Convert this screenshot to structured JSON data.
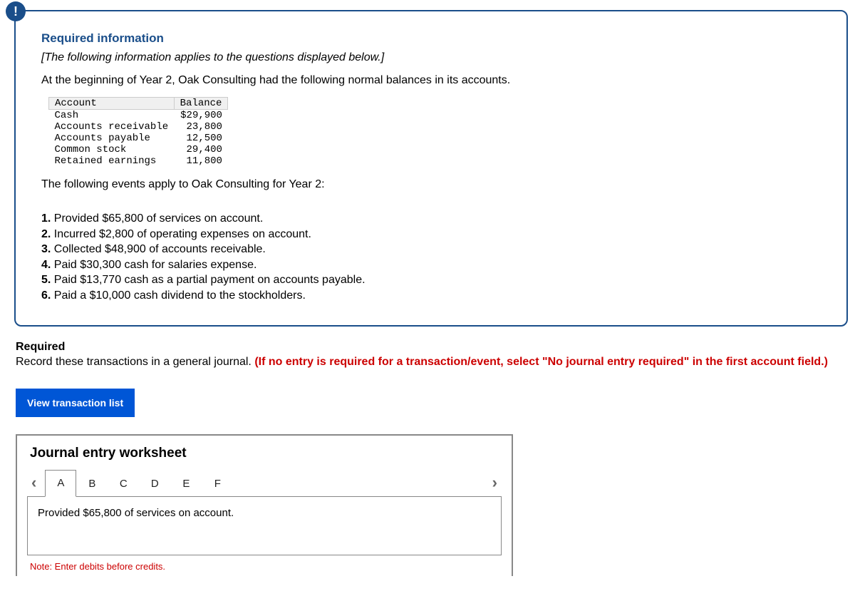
{
  "info": {
    "heading": "Required information",
    "applies": "[The following information applies to the questions displayed below.]",
    "narrative": "At the beginning of Year 2, Oak Consulting had the following normal balances in its accounts.",
    "balances": {
      "header_account": "Account",
      "header_balance": "Balance",
      "rows": [
        {
          "account": "Cash",
          "balance": "$29,900"
        },
        {
          "account": "Accounts receivable",
          "balance": "23,800"
        },
        {
          "account": "Accounts payable",
          "balance": "12,500"
        },
        {
          "account": "Common stock",
          "balance": "29,400"
        },
        {
          "account": "Retained earnings",
          "balance": "11,800"
        }
      ]
    },
    "events_intro": "The following events apply to Oak Consulting for Year 2:",
    "events": [
      {
        "n": "1.",
        "text": "Provided $65,800 of services on account."
      },
      {
        "n": "2.",
        "text": "Incurred $2,800 of operating expenses on account."
      },
      {
        "n": "3.",
        "text": "Collected $48,900 of accounts receivable."
      },
      {
        "n": "4.",
        "text": "Paid $30,300 cash for salaries expense."
      },
      {
        "n": "5.",
        "text": "Paid $13,770 cash as a partial payment on accounts payable."
      },
      {
        "n": "6.",
        "text": "Paid a $10,000 cash dividend to the stockholders."
      }
    ]
  },
  "required": {
    "label": "Required",
    "text_before": "Record these transactions in a general journal. ",
    "text_red": "(If no entry is required for a transaction/event, select \"No journal entry required\" in the first account field.)"
  },
  "button": {
    "view_list": "View transaction list"
  },
  "worksheet": {
    "title": "Journal entry worksheet",
    "tabs": [
      "A",
      "B",
      "C",
      "D",
      "E",
      "F"
    ],
    "active_tab": 0,
    "body": "Provided $65,800 of services on account.",
    "note": "Note: Enter debits before credits."
  },
  "icons": {
    "alert": "!",
    "prev": "‹",
    "next": "›"
  }
}
